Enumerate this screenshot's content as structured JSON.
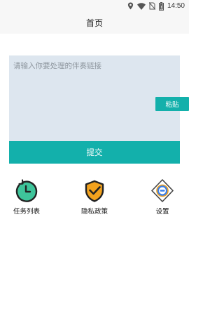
{
  "status_bar": {
    "time": "14:50",
    "icons": [
      "location-icon",
      "wifi-icon",
      "no-sim-icon",
      "battery-icon"
    ]
  },
  "header": {
    "title": "首页"
  },
  "input": {
    "value": "",
    "placeholder": "请输入你要处理的伴奏链接"
  },
  "paste_button": {
    "label": "粘贴"
  },
  "submit_button": {
    "label": "提交"
  },
  "tools": [
    {
      "icon": "clock-refresh-icon",
      "label": "任务列表"
    },
    {
      "icon": "shield-check-icon",
      "label": "隐私政策"
    },
    {
      "icon": "settings-gear-icon",
      "label": "设置"
    }
  ],
  "colors": {
    "accent": "#13b0ab",
    "input_bg": "#dde6ef",
    "header_bg": "#f7f7f7",
    "icon_green": "#3ec49a",
    "icon_orange": "#f2a21e",
    "icon_blue": "#3a7fe8"
  }
}
